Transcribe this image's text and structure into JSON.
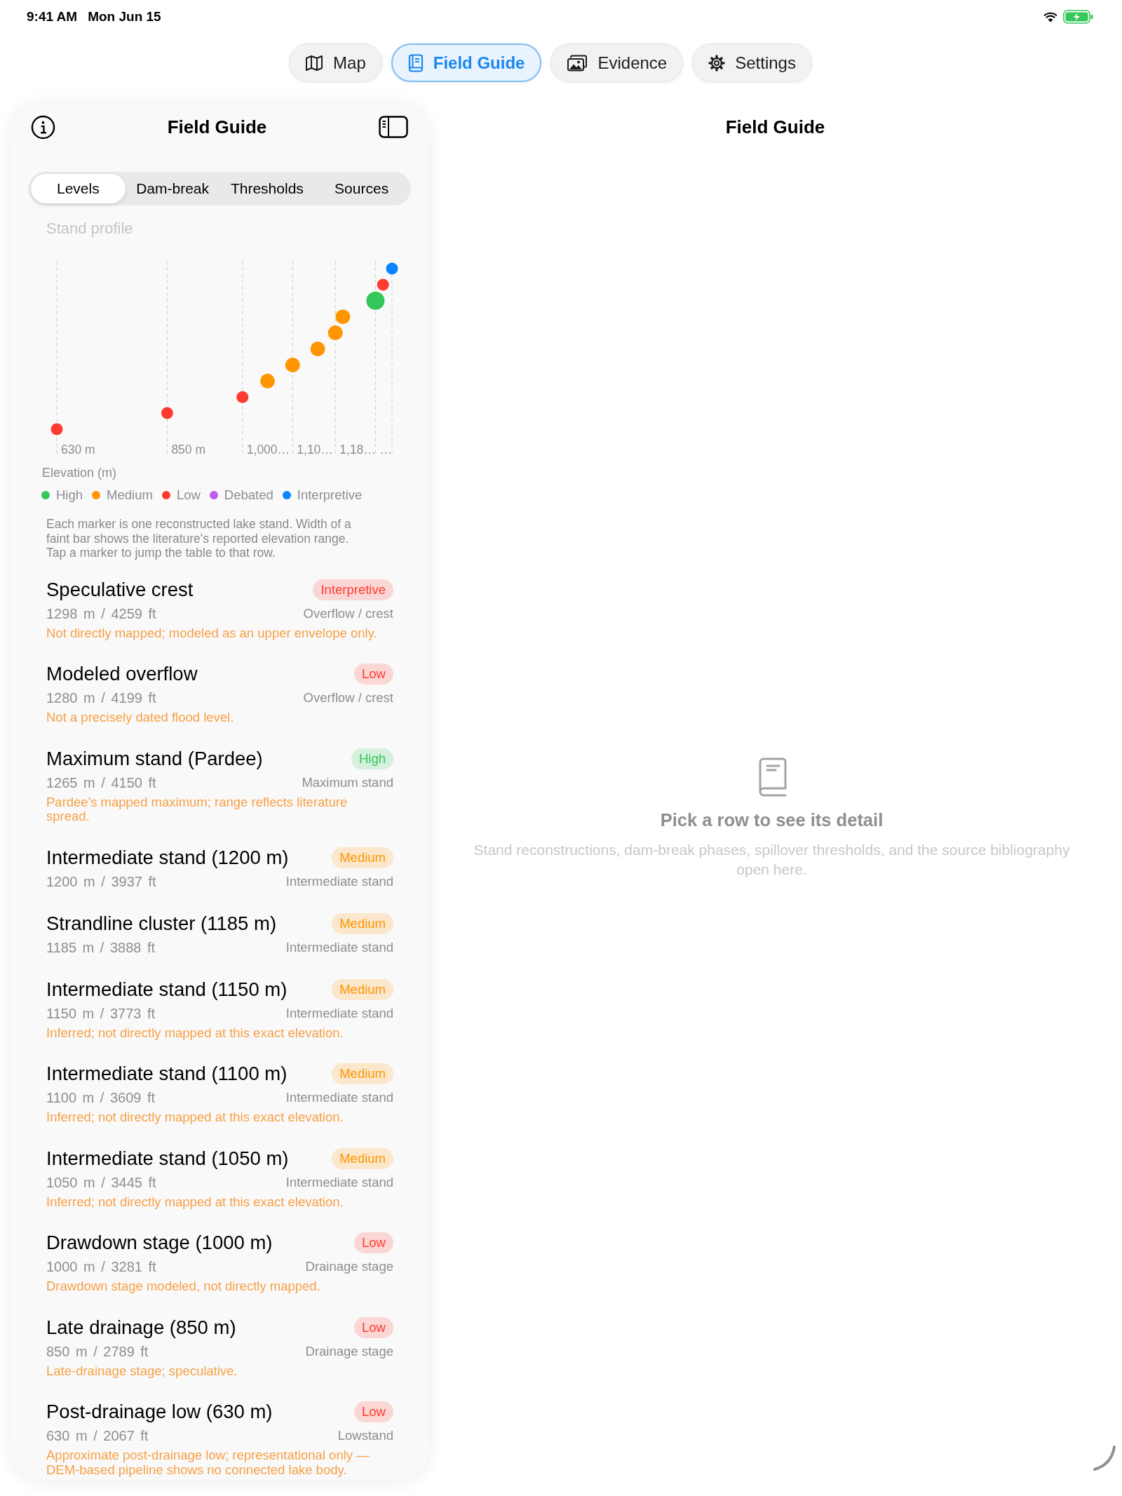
{
  "status_bar": {
    "time": "9:41 AM",
    "date": "Mon Jun 15"
  },
  "top_tabs": [
    {
      "label": "Map",
      "selected": false
    },
    {
      "label": "Field Guide",
      "selected": true
    },
    {
      "label": "Evidence",
      "selected": false
    },
    {
      "label": "Settings",
      "selected": false
    }
  ],
  "sidebar": {
    "title": "Field Guide",
    "segments": [
      {
        "label": "Levels",
        "selected": true
      },
      {
        "label": "Dam-break",
        "selected": false
      },
      {
        "label": "Thresholds",
        "selected": false
      },
      {
        "label": "Sources",
        "selected": false
      }
    ],
    "profile": {
      "title": "Stand profile",
      "axis_labels": [
        "630 m",
        "850 m",
        "1,000…",
        "1,10…",
        "1,18…",
        "…"
      ],
      "axis_title": "Elevation (m)",
      "markers": [
        {
          "color": "#ff3b30"
        },
        {
          "color": "#ff3b30"
        },
        {
          "color": "#ff3b30"
        },
        {
          "color": "#ff9500"
        },
        {
          "color": "#ff9500"
        },
        {
          "color": "#ff9500"
        },
        {
          "color": "#ff9500"
        },
        {
          "color": "#ff9500"
        },
        {
          "color": "#34c759"
        },
        {
          "color": "#ff3b30"
        },
        {
          "color": "#0a84ff"
        }
      ],
      "legend": [
        {
          "label": "High",
          "color": "#34c759"
        },
        {
          "label": "Medium",
          "color": "#ff9500"
        },
        {
          "label": "Low",
          "color": "#ff3b30"
        },
        {
          "label": "Debated",
          "color": "#bf5af2"
        },
        {
          "label": "Interpretive",
          "color": "#0a84ff"
        }
      ]
    },
    "description": "Each marker is one reconstructed lake stand. Width of a faint bar shows the literature's reported elevation range. Tap a marker to jump the table to that row.",
    "rows": [
      {
        "name": "Speculative crest",
        "badge": {
          "label": "Interpretive",
          "color": "#ff3b30"
        },
        "elevation": "1298 m / 4259 ft",
        "type": "Overflow / crest",
        "note": "Not directly mapped; modeled as an upper envelope only."
      },
      {
        "name": "Modeled overflow",
        "badge": {
          "label": "Low",
          "color": "#ff3b30"
        },
        "elevation": "1280 m / 4199 ft",
        "type": "Overflow / crest",
        "note": "Not a precisely dated flood level."
      },
      {
        "name": "Maximum stand (Pardee)",
        "badge": {
          "label": "High",
          "color": "#34c759"
        },
        "elevation": "1265 m / 4150 ft",
        "type": "Maximum stand",
        "note": "Pardee's mapped maximum; range reflects literature spread."
      },
      {
        "name": "Intermediate stand (1200 m)",
        "badge": {
          "label": "Medium",
          "color": "#ff9500"
        },
        "elevation": "1200 m / 3937 ft",
        "type": "Intermediate stand"
      },
      {
        "name": "Strandline cluster (1185 m)",
        "badge": {
          "label": "Medium",
          "color": "#ff9500"
        },
        "elevation": "1185 m / 3888 ft",
        "type": "Intermediate stand"
      },
      {
        "name": "Intermediate stand (1150 m)",
        "badge": {
          "label": "Medium",
          "color": "#ff9500"
        },
        "elevation": "1150 m / 3773 ft",
        "type": "Intermediate stand",
        "note": "Inferred; not directly mapped at this exact elevation."
      },
      {
        "name": "Intermediate stand (1100 m)",
        "badge": {
          "label": "Medium",
          "color": "#ff9500"
        },
        "elevation": "1100 m / 3609 ft",
        "type": "Intermediate stand",
        "note": "Inferred; not directly mapped at this exact elevation."
      },
      {
        "name": "Intermediate stand (1050 m)",
        "badge": {
          "label": "Medium",
          "color": "#ff9500"
        },
        "elevation": "1050 m / 3445 ft",
        "type": "Intermediate stand",
        "note": "Inferred; not directly mapped at this exact elevation."
      },
      {
        "name": "Drawdown stage (1000 m)",
        "badge": {
          "label": "Low",
          "color": "#ff3b30"
        },
        "elevation": "1000 m / 3281 ft",
        "type": "Drainage stage",
        "note": "Drawdown stage modeled, not directly mapped."
      },
      {
        "name": "Late drainage (850 m)",
        "badge": {
          "label": "Low",
          "color": "#ff3b30"
        },
        "elevation": "850 m / 2789 ft",
        "type": "Drainage stage",
        "note": "Late-drainage stage; speculative."
      },
      {
        "name": "Post-drainage low (630 m)",
        "badge": {
          "label": "Low",
          "color": "#ff3b30"
        },
        "elevation": "630 m / 2067 ft",
        "type": "Lowstand",
        "note": "Approximate post-drainage low; representational only — DEM-based pipeline shows no connected lake body."
      }
    ]
  },
  "detail": {
    "title": "Field Guide",
    "empty_title": "Pick a row to see its detail",
    "empty_message": "Stand reconstructions, dam-break phases, spillover thresholds, and the source bibliography open here."
  }
}
